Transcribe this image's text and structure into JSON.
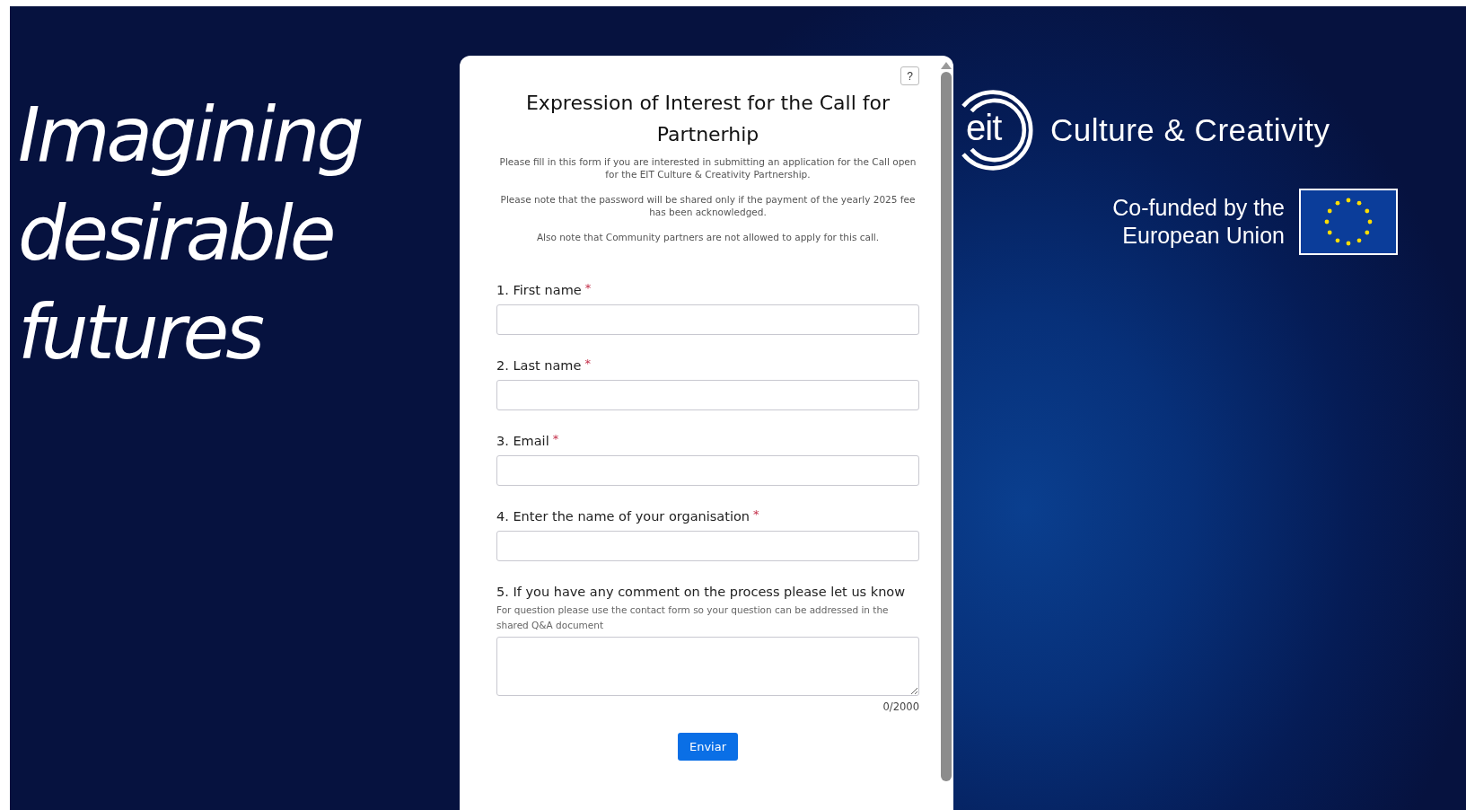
{
  "hero": {
    "lines": [
      "Imagining",
      "desirable",
      "futures"
    ]
  },
  "brand": {
    "logo_text": "eit",
    "name": "Culture & Creativity"
  },
  "funding": {
    "lines": [
      "Co-funded by the",
      "European Union"
    ]
  },
  "form": {
    "help_button": "?",
    "title": "Expression of Interest for the Call for Partnerhip",
    "intro": [
      "Please fill in this form if you are interested in submitting an application for the Call open for the EIT Culture & Creativity Partnership.",
      "Please note that the password will be shared only if the payment of the yearly 2025 fee has been acknowledged.",
      "Also note that Community partners are not allowed to apply for this call."
    ],
    "questions": [
      {
        "kind": "text",
        "label": "1. First name",
        "required_mark": "*"
      },
      {
        "kind": "text",
        "label": "2. Last name",
        "required_mark": "*"
      },
      {
        "kind": "text",
        "label": "3. Email",
        "required_mark": "*"
      },
      {
        "kind": "text",
        "label": "4. Enter the name of your organisation",
        "required_mark": "*"
      },
      {
        "kind": "textarea",
        "label": "5. If you have any comment on the process please let us know",
        "hint": "For question please use the contact form so your question can be addressed in the shared Q&A document",
        "counter": "0/2000"
      }
    ],
    "submit": "Enviar"
  }
}
